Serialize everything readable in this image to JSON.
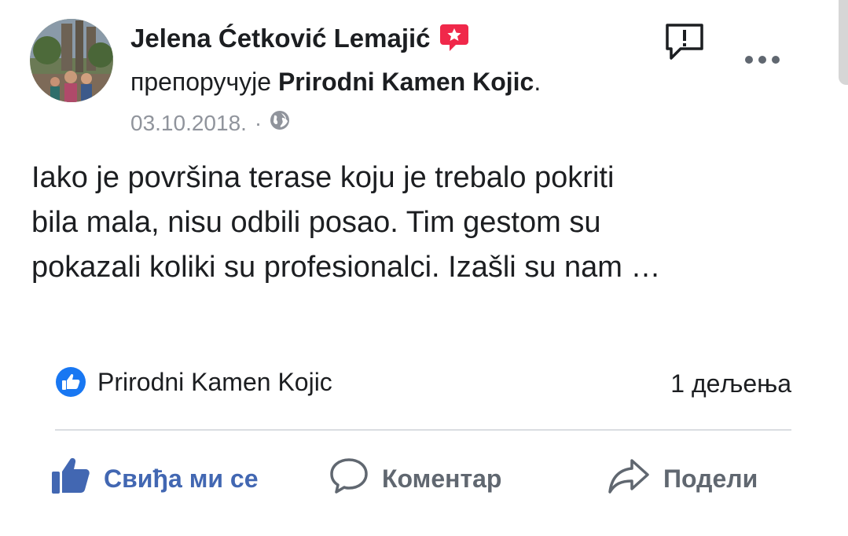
{
  "post": {
    "author": "Jelena Ćetković Lemajić",
    "recommends": "препоручује",
    "page_name": "Prirodni Kamen Kojic",
    "period": ".",
    "date": "03.10.2018.",
    "separator": "·",
    "text_lines": [
      "Iako je površina terase koju je trebalo pokriti",
      "bila mala, nisu odbili posao. Tim gestom su",
      "pokazali koliki su profesionalci. Izašli su nam …"
    ]
  },
  "reactions": {
    "liked_by": "Prirodni Kamen Kojic",
    "shares": "1 дељења"
  },
  "actions": {
    "like": "Свиђа ми се",
    "comment": "Коментар",
    "share": "Подели"
  },
  "icons": {
    "recommend": "recommend-badge-icon",
    "report": "report-icon",
    "more": "more-icon",
    "privacy": "globe-icon",
    "like_reaction": "like-reaction-icon",
    "like_action": "thumbs-up-icon",
    "comment": "comment-icon",
    "share": "share-arrow-icon"
  },
  "colors": {
    "accent": "#4267b2",
    "reaction_blue": "#1877f2",
    "recommend_red": "#f0284a",
    "muted": "#90949c",
    "action_gray": "#606770"
  }
}
